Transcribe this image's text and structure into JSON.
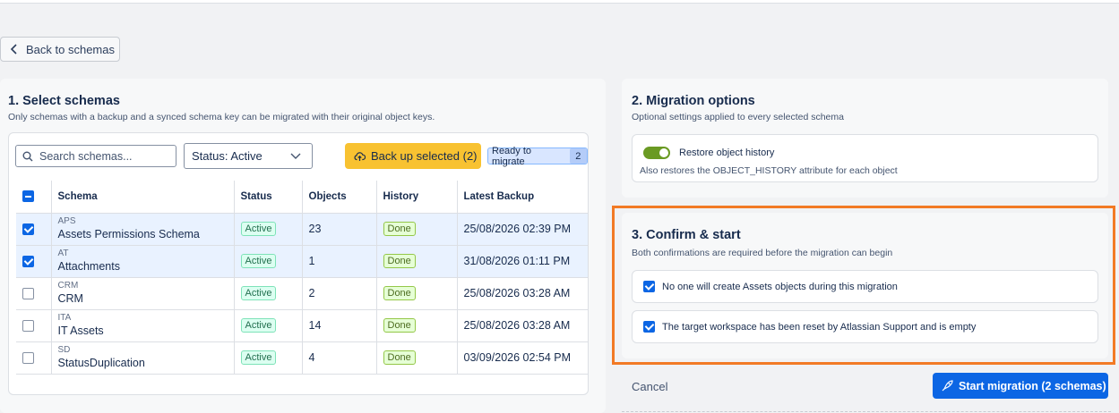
{
  "back_label": "Back to schemas",
  "select": {
    "title": "1. Select schemas",
    "subtitle": "Only schemas with a backup and a synced schema key can be migrated with their original object keys.",
    "search_placeholder": "Search schemas...",
    "status_filter": "Status: Active",
    "backup_button": "Back up selected (2)",
    "ready_label": "Ready to migrate",
    "ready_count": "2",
    "columns": [
      "Schema",
      "Status",
      "Objects",
      "History",
      "Latest Backup"
    ],
    "rows": [
      {
        "code": "APS",
        "name": "Assets Permissions Schema",
        "status": "Active",
        "objects": "23",
        "history": "Done",
        "backup": "25/08/2026 02:39 PM",
        "checked": true
      },
      {
        "code": "AT",
        "name": "Attachments",
        "status": "Active",
        "objects": "1",
        "history": "Done",
        "backup": "31/08/2026 01:11 PM",
        "checked": true
      },
      {
        "code": "CRM",
        "name": "CRM",
        "status": "Active",
        "objects": "2",
        "history": "Done",
        "backup": "25/08/2026 03:28 AM",
        "checked": false
      },
      {
        "code": "ITA",
        "name": "IT Assets",
        "status": "Active",
        "objects": "14",
        "history": "Done",
        "backup": "25/08/2026 03:28 AM",
        "checked": false
      },
      {
        "code": "SD",
        "name": "StatusDuplication",
        "status": "Active",
        "objects": "4",
        "history": "Done",
        "backup": "03/09/2026 02:54 PM",
        "checked": false
      }
    ]
  },
  "options": {
    "title": "2. Migration options",
    "subtitle": "Optional settings applied to every selected schema",
    "restore_label": "Restore object history",
    "restore_desc": "Also restores the OBJECT_HISTORY attribute for each object",
    "restore_on": true
  },
  "confirm": {
    "title": "3. Confirm & start",
    "subtitle": "Both confirmations are required before the migration can begin",
    "check1": "No one will create Assets objects during this migration",
    "check2": "The target workspace has been reset by Atlassian Support and is empty"
  },
  "footer": {
    "cancel": "Cancel",
    "start": "Start migration (2 schemas)"
  },
  "colors": {
    "accent": "#0c66e4",
    "highlight": "#f27a25",
    "backup": "#f8c231"
  }
}
